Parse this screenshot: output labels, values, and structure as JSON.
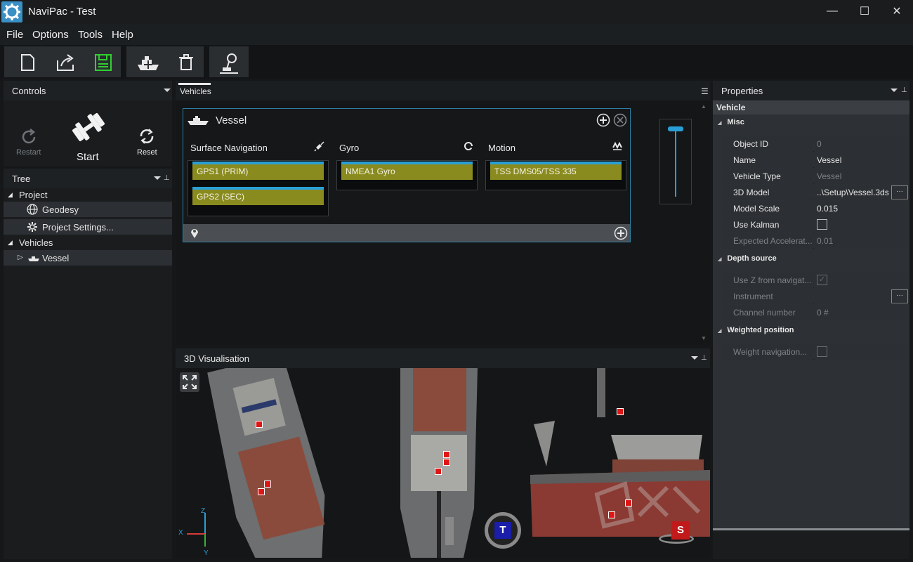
{
  "window": {
    "title": "NaviPac  - Test",
    "minimize": "—",
    "maximize": "☐",
    "close": "✕"
  },
  "menu": [
    "File",
    "Options",
    "Tools",
    "Help"
  ],
  "panels": {
    "controls": {
      "title": "Controls",
      "restart": "Restart",
      "start": "Start",
      "reset": "Reset"
    },
    "tree": {
      "title": "Tree",
      "items": [
        {
          "label": "Project"
        },
        {
          "label": "Geodesy"
        },
        {
          "label": "Project Settings..."
        },
        {
          "label": "Vehicles"
        },
        {
          "label": "Vessel"
        }
      ]
    },
    "vehicles": {
      "tab": "Vehicles",
      "card_title": "Vessel",
      "sections": [
        {
          "title": "Surface Navigation",
          "items": [
            "GPS1 (PRIM)",
            "GPS2 (SEC)"
          ]
        },
        {
          "title": "Gyro",
          "items": [
            "NMEA1 Gyro"
          ]
        },
        {
          "title": "Motion",
          "items": [
            "TSS DMS05/TSS 335"
          ]
        }
      ]
    },
    "visualisation": {
      "title": "3D Visualisation",
      "axis_x": "X",
      "axis_y": "Y",
      "axis_z": "Z",
      "btn_t": "T",
      "btn_s": "S"
    },
    "properties": {
      "title": "Properties",
      "header": "Vehicle",
      "categories": {
        "misc": "Misc",
        "depth": "Depth source",
        "weighted": "Weighted position"
      },
      "misc": [
        {
          "name": "Object ID",
          "value": "0"
        },
        {
          "name": "Name",
          "value": "Vessel"
        },
        {
          "name": "Vehicle Type",
          "value": "Vessel"
        },
        {
          "name": "3D Model",
          "value": "..\\Setup\\Vessel.3ds"
        },
        {
          "name": "Model Scale",
          "value": "0.015"
        },
        {
          "name": "Use Kalman",
          "value": ""
        },
        {
          "name": "Expected Accelerat...",
          "value": "0.01"
        }
      ],
      "depth": [
        {
          "name": "Use Z from navigat...",
          "value": ""
        },
        {
          "name": "Instrument",
          "value": ""
        },
        {
          "name": "Channel number",
          "value": "0 #"
        }
      ],
      "weighted": [
        {
          "name": "Weight navigation...",
          "value": ""
        }
      ],
      "ellipsis": "···"
    }
  },
  "colors": {
    "accent": "#2a9fd6",
    "sensor": "#8a8b1f",
    "save_green": "#2fd12f",
    "marker_red": "#e01616"
  }
}
